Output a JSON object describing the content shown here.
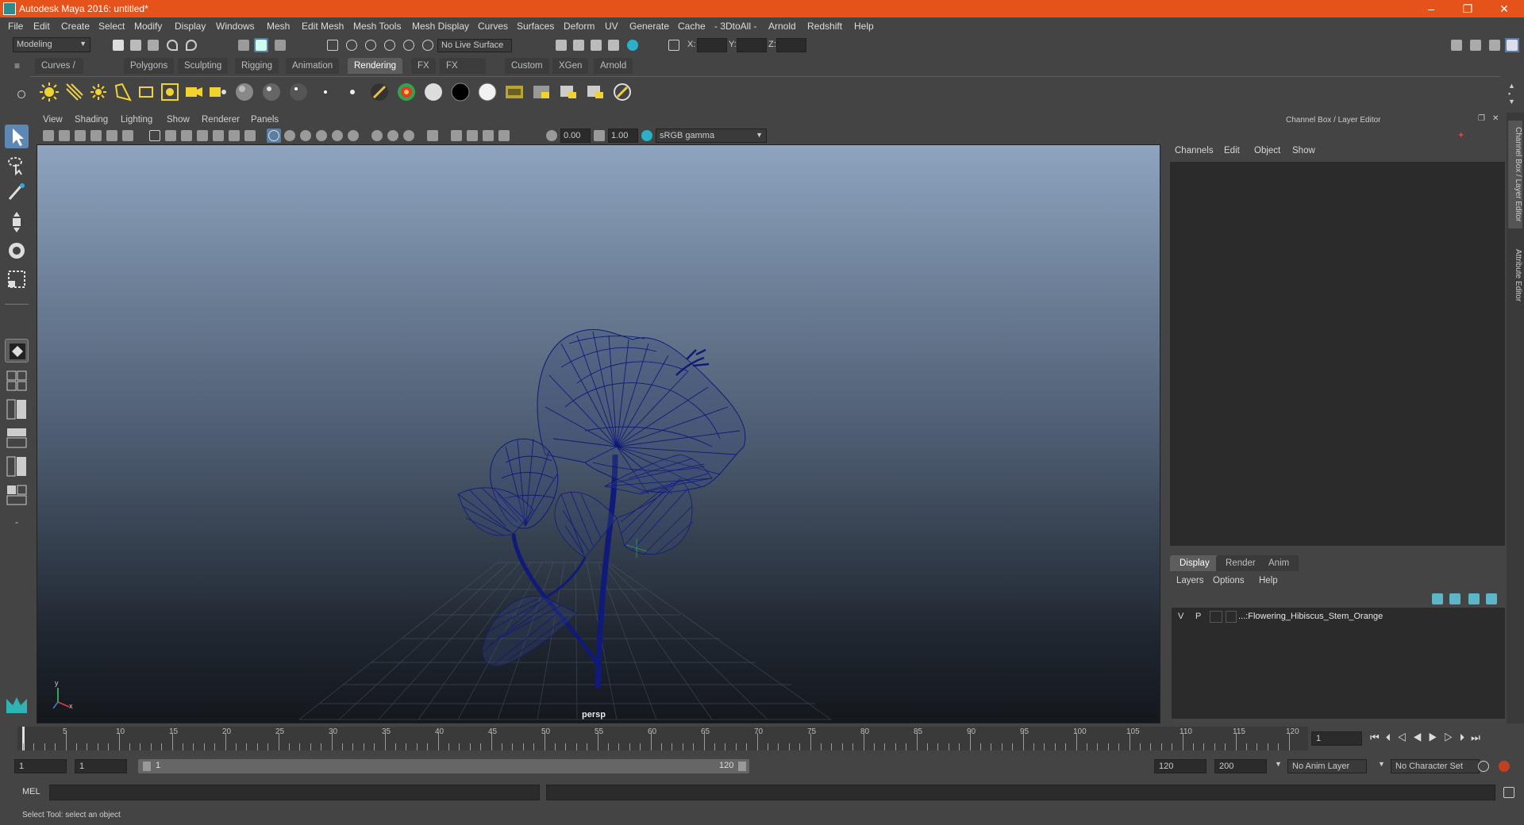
{
  "window": {
    "title": "Autodesk Maya 2016: untitled*",
    "minimize": "–",
    "maximize": "❐",
    "close": "✕"
  },
  "menubar": [
    "File",
    "Edit",
    "Create",
    "Select",
    "Modify",
    "Display",
    "Windows",
    "Mesh",
    "Edit Mesh",
    "Mesh Tools",
    "Mesh Display",
    "Curves",
    "Surfaces",
    "Deform",
    "UV",
    "Generate",
    "Cache",
    "- 3DtoAll -",
    "Arnold",
    "Redshift",
    "Help"
  ],
  "statusline": {
    "mode": "Modeling",
    "live_surface": "No Live Surface",
    "x_label": "X:",
    "y_label": "Y:",
    "z_label": "Z:",
    "x_value": "",
    "y_value": "",
    "z_value": ""
  },
  "shelf": {
    "tabs": [
      "Curves / Surfaces",
      "Polygons",
      "Sculpting",
      "Rigging",
      "Animation",
      "Rendering",
      "FX",
      "FX Caching",
      "Custom",
      "XGen",
      "Arnold"
    ],
    "active_tab": "Rendering"
  },
  "viewport": {
    "menus": [
      "View",
      "Shading",
      "Lighting",
      "Show",
      "Renderer",
      "Panels"
    ],
    "exposure": "0.00",
    "gamma": "1.00",
    "color_space": "sRGB gamma",
    "camera_label": "persp",
    "axis_labels": {
      "y": "y",
      "x": "x"
    }
  },
  "right_panel": {
    "title": "Channel Box / Layer Editor",
    "channel_menus": [
      "Channels",
      "Edit",
      "Object",
      "Show"
    ],
    "layer_tabs": [
      "Display",
      "Render",
      "Anim"
    ],
    "active_layer_tab": "Display",
    "layer_menus": [
      "Layers",
      "Options",
      "Help"
    ],
    "layers": [
      {
        "v": "V",
        "p": "P",
        "name": "...:Flowering_Hibiscus_Stem_Orange"
      }
    ],
    "side_tabs": [
      "Channel Box / Layer Editor",
      "Attribute Editor"
    ]
  },
  "timeline": {
    "ticks": [
      "5",
      "10",
      "15",
      "20",
      "25",
      "30",
      "35",
      "40",
      "45",
      "50",
      "55",
      "60",
      "65",
      "70",
      "75",
      "80",
      "85",
      "90",
      "95",
      "100",
      "105",
      "110",
      "115",
      "120"
    ],
    "start_label": "1",
    "current_frame": "1"
  },
  "range": {
    "start": "1",
    "playback_start": "1",
    "slider_start": "1",
    "slider_end": "120",
    "playback_end": "120",
    "end": "200",
    "anim_layer": "No Anim Layer",
    "character_set": "No Character Set"
  },
  "command": {
    "label": "MEL",
    "input": ""
  },
  "help_line": "Select Tool: select an object",
  "colors": {
    "titlebar": "#e5531a",
    "wireframe": "#0f1a7a",
    "active_tab": "#5d5d5d"
  }
}
